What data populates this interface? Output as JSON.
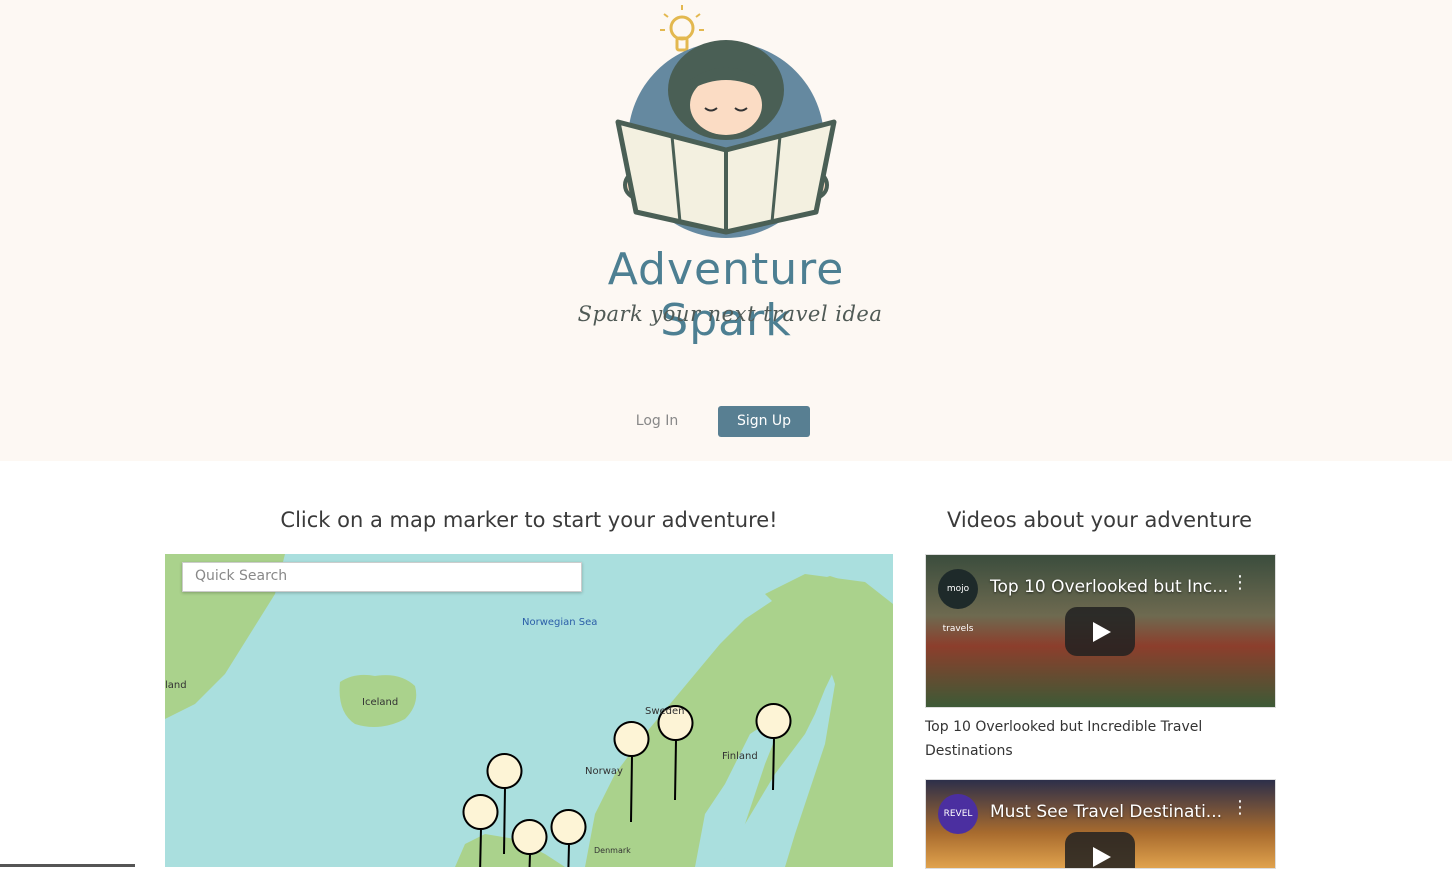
{
  "header": {
    "brand_name": "Adventure Spark",
    "tagline": "Spark your next travel idea",
    "login_label": "Log In",
    "signup_label": "Sign Up",
    "accent_color": "#587f92",
    "background_color": "#fdf8f3"
  },
  "map_section": {
    "heading": "Click on a map marker to start your adventure!",
    "search_placeholder": "Quick Search",
    "labels": {
      "norwegian_sea": "Norwegian Sea",
      "iceland": "Iceland",
      "sweden": "Sweden",
      "norway": "Norway",
      "finland": "Finland",
      "denmark": "Denmark",
      "greenland_partial": "land"
    }
  },
  "videos_section": {
    "heading": "Videos about your adventure",
    "videos": [
      {
        "title": "Top 10 Overlooked but Inc...",
        "channel": "mojo travels",
        "caption": "Top 10 Overlooked but Incredible Travel Destinations"
      },
      {
        "title": "Must See Travel Destinati...",
        "channel": "REVEL",
        "caption": ""
      }
    ]
  }
}
